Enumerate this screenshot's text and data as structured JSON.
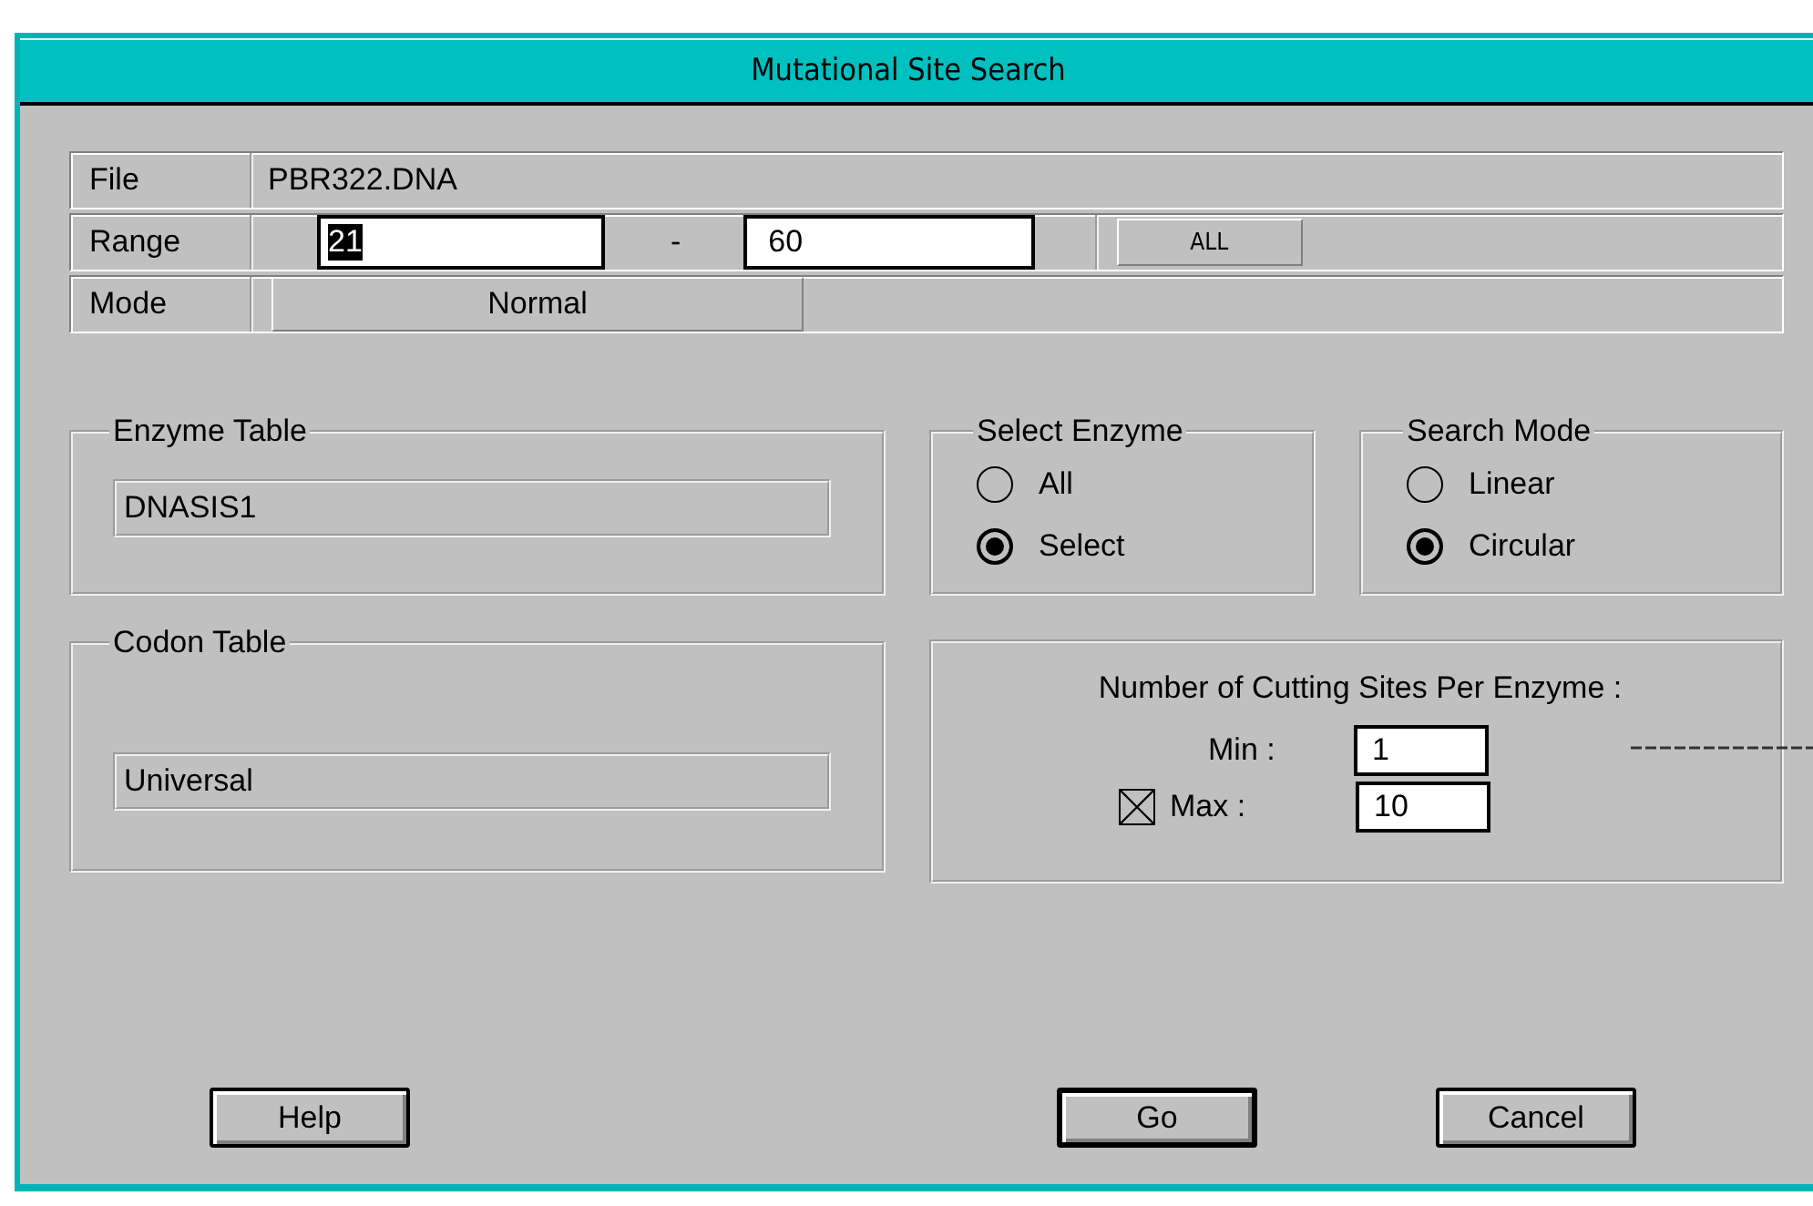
{
  "window": {
    "title": "Mutational Site Search"
  },
  "file": {
    "label": "File",
    "value": "PBR322.DNA"
  },
  "range": {
    "label": "Range",
    "from": "21",
    "from_selected": true,
    "separator": "-",
    "to": "60",
    "all_button": "ALL"
  },
  "mode": {
    "label": "Mode",
    "value": "Normal"
  },
  "enzyme_table": {
    "title": "Enzyme Table",
    "value": "DNASIS1"
  },
  "select_enzyme": {
    "title": "Select Enzyme",
    "options": [
      {
        "label": "All",
        "selected": false
      },
      {
        "label": "Select",
        "selected": true
      }
    ]
  },
  "search_mode": {
    "title": "Search Mode",
    "options": [
      {
        "label": "Linear",
        "selected": false
      },
      {
        "label": "Circular",
        "selected": true
      }
    ]
  },
  "codon_table": {
    "title": "Codon Table",
    "value": "Universal"
  },
  "cutting_sites": {
    "title": "Number of Cutting Sites Per Enzyme :",
    "min": {
      "label": "Min :",
      "value": "1"
    },
    "max": {
      "label": "Max :",
      "value": "10",
      "checked": true
    }
  },
  "buttons": [
    {
      "label": "Help",
      "default": false
    },
    {
      "label": "Go",
      "default": true
    },
    {
      "label": "Cancel",
      "default": false
    }
  ]
}
